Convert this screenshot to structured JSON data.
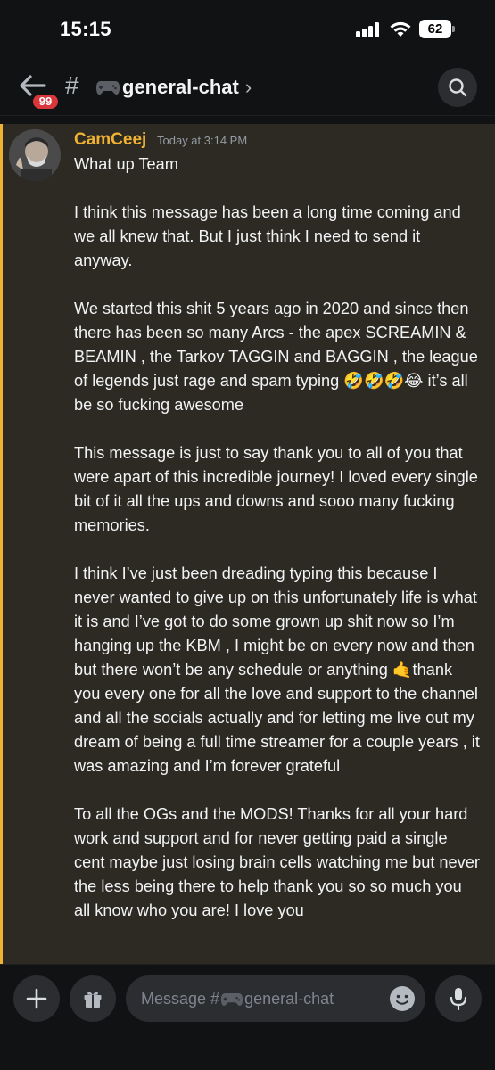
{
  "status_bar": {
    "time": "15:15",
    "battery": "62"
  },
  "header": {
    "unread_count": "99",
    "hash": "#",
    "channel_name": "general-chat",
    "chevron": "›",
    "icons": [
      "back-arrow-icon",
      "game-controller-icon",
      "search-icon"
    ]
  },
  "message": {
    "author": "CamCeej",
    "timestamp": "Today at 3:14 PM",
    "author_color": "#f0b232",
    "paragraphs": [
      "What up Team",
      "I think this message has been a long time coming and we all knew that. But I just think I need to send it anyway.",
      "We started this shit 5 years ago in 2020 and since then there has been so many Arcs - the apex SCREAMIN & BEAMIN , the Tarkov TAGGIN and BAGGIN , the league of legends just rage and spam typing 🤣🤣🤣😂 it’s all be so fucking awesome",
      "This message is just to say thank you to all of you that were apart of this incredible journey! I loved every single bit of it all the ups and downs and sooo many fucking memories.",
      "I think I’ve just been dreading typing this because I never wanted to give up on this unfortunately life is what it is and I’ve got to do some grown up shit now so I’m hanging up the KBM , I might be on every now and then but there won’t be any schedule or anything 🤙thank you every one for all the love and support to the channel and all the socials actually and for letting me live out my dream of being a full time streamer for a couple years ,  it was amazing and I’m forever grateful",
      "To all the OGs and the MODS! Thanks for all your hard work and support and for never getting paid a single cent maybe just losing brain cells watching me but never the less being there to help thank you so so much you all know who you are! I love you"
    ]
  },
  "composer": {
    "placeholder_prefix": "Message #",
    "placeholder_channel": "general-chat",
    "icons": [
      "plus-icon",
      "gift-icon",
      "emoji-icon",
      "microphone-icon"
    ]
  },
  "colors": {
    "background": "#111214",
    "mention_highlight": "#2c2a23",
    "mention_bar": "#f0b232",
    "badge": "#da373c"
  }
}
